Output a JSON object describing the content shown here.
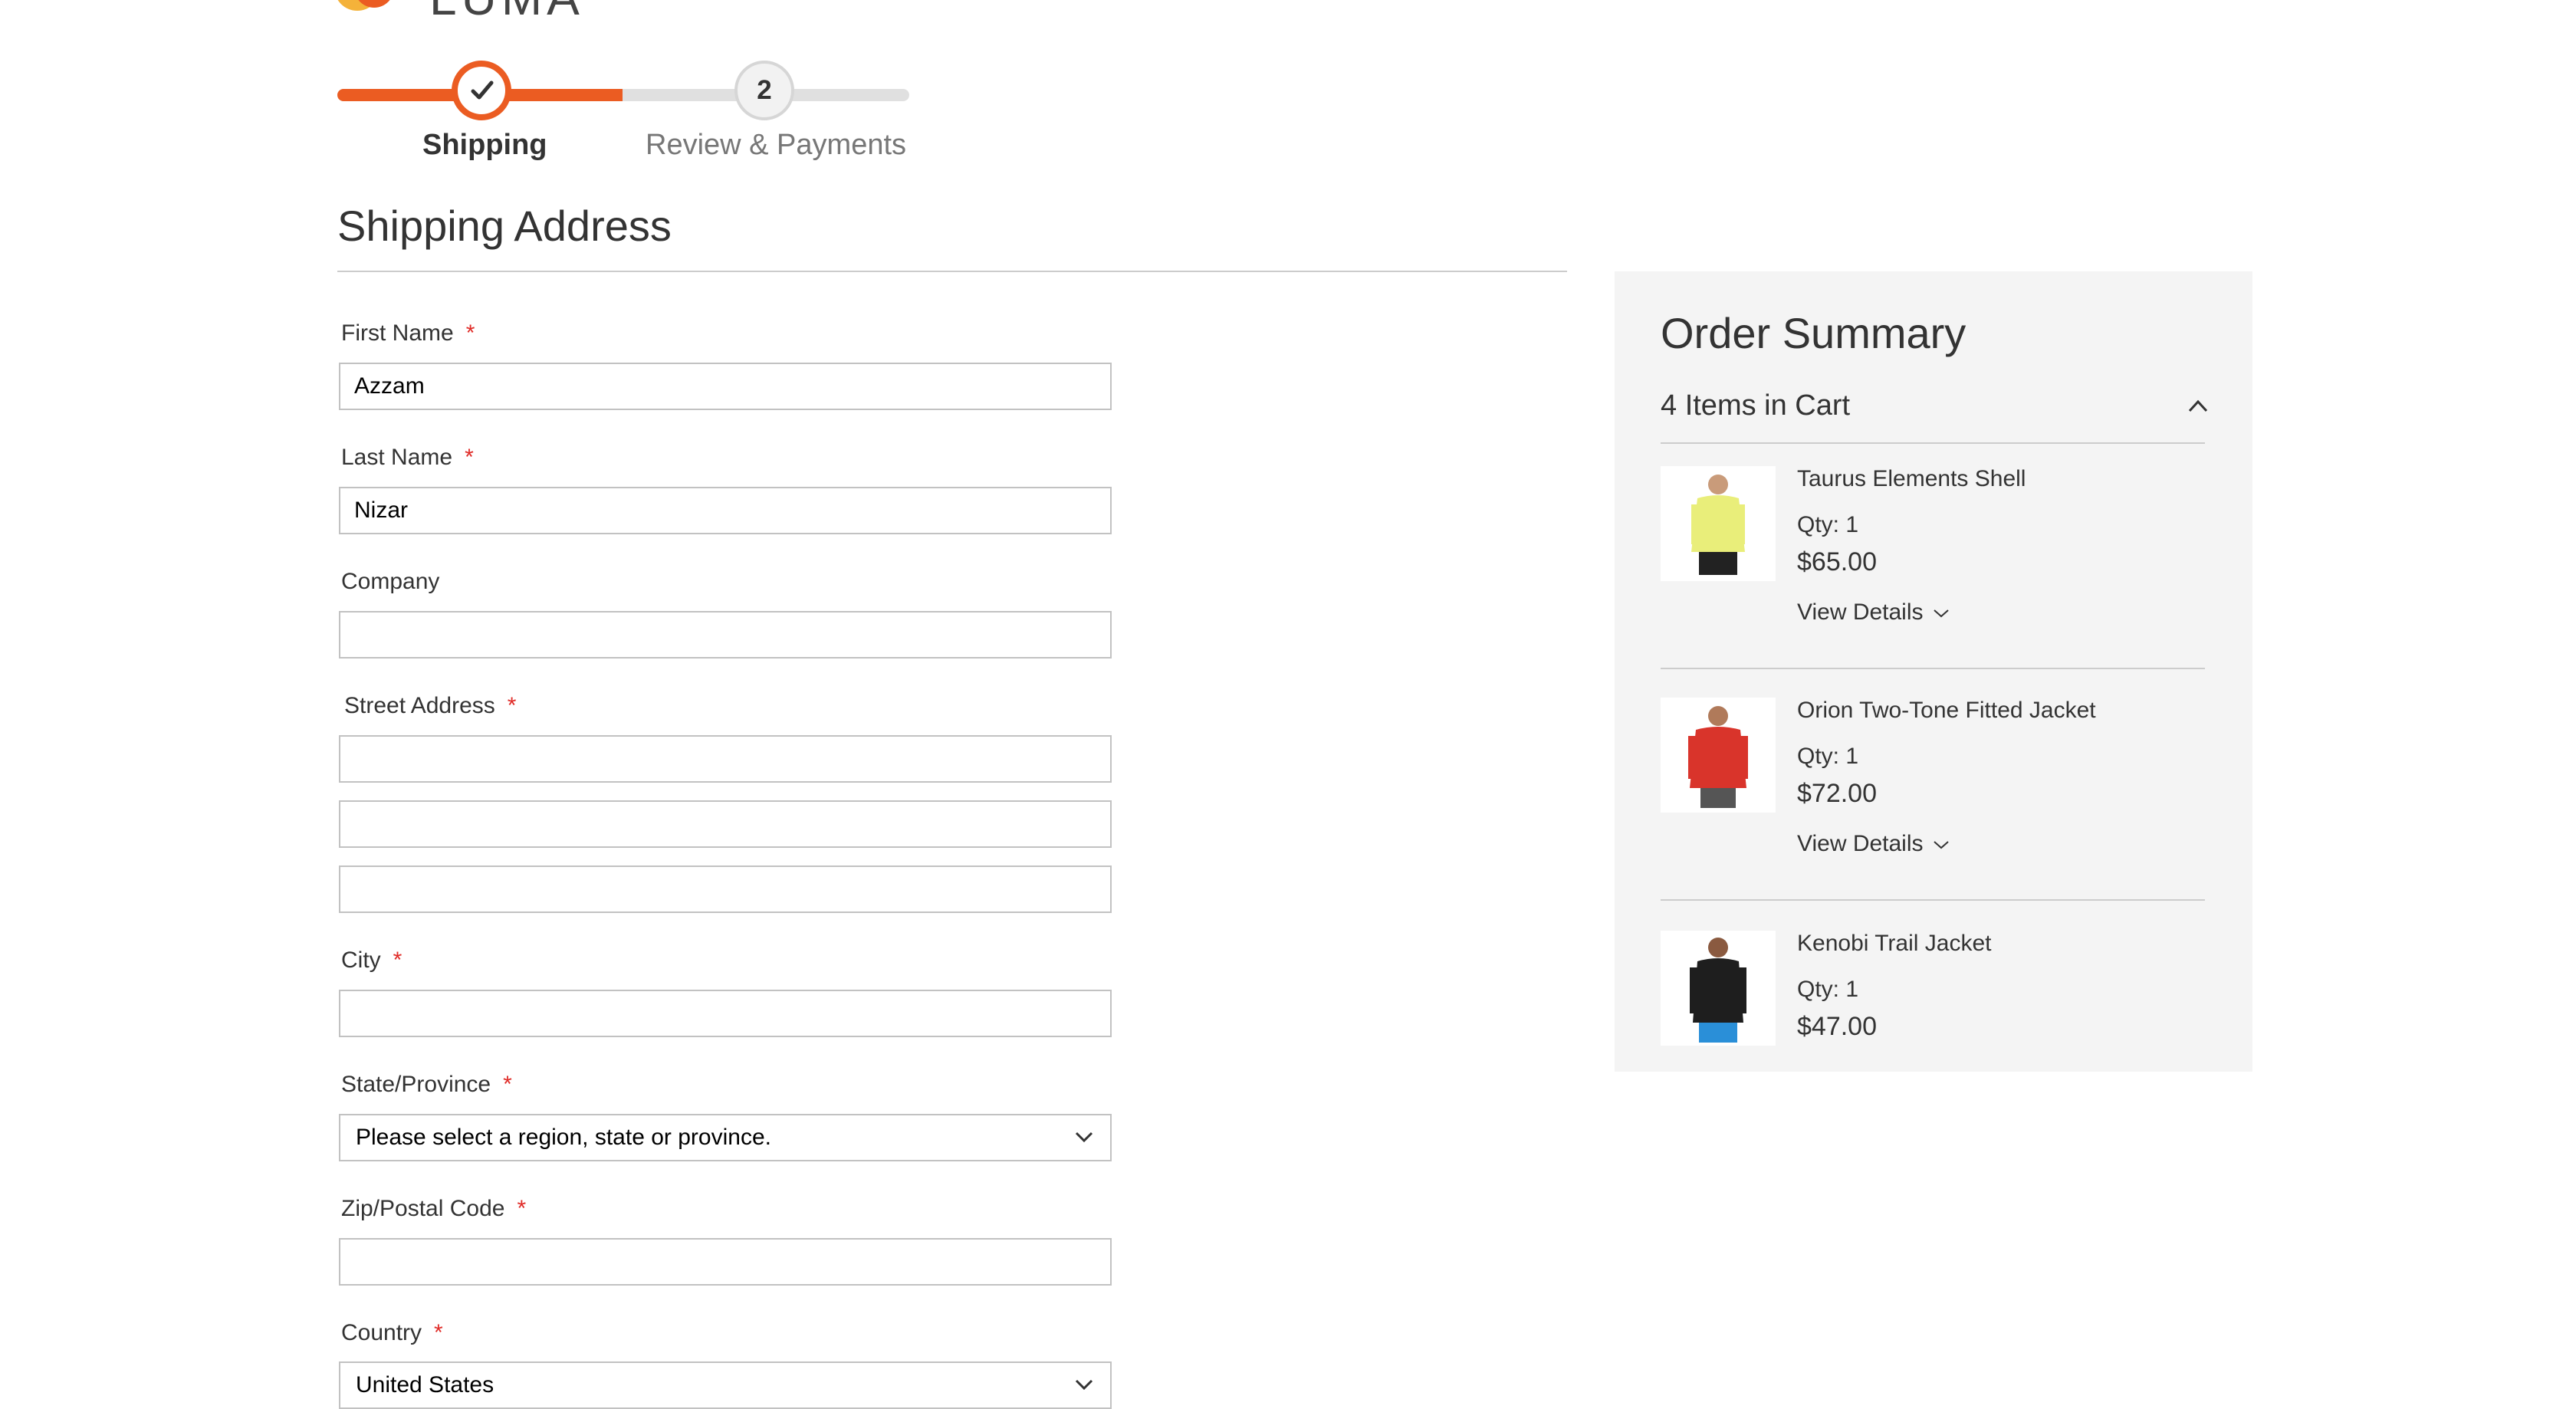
{
  "logo": {
    "text": "LUMA"
  },
  "steps": [
    {
      "number": "1",
      "label": "Shipping"
    },
    {
      "number": "2",
      "label": "Review & Payments"
    }
  ],
  "shipping": {
    "title": "Shipping Address",
    "first_name": {
      "label": "First Name",
      "value": "Azzam"
    },
    "last_name": {
      "label": "Last Name",
      "value": "Nizar"
    },
    "company": {
      "label": "Company",
      "value": ""
    },
    "street": {
      "label": "Street Address",
      "line1": "",
      "line2": "",
      "line3": ""
    },
    "city": {
      "label": "City",
      "value": ""
    },
    "state": {
      "label": "State/Province",
      "value": "Please select a region, state or province."
    },
    "zip": {
      "label": "Zip/Postal Code",
      "value": ""
    },
    "country": {
      "label": "Country",
      "value": "United States"
    },
    "required_mark": "*"
  },
  "summary": {
    "title": "Order Summary",
    "cart_count": "4 Items in Cart",
    "items": [
      {
        "name": "Taurus Elements Shell",
        "qty": "Qty: 1",
        "price": "$65.00",
        "details": "View Details",
        "color": "#e9ee7a"
      },
      {
        "name": "Orion Two-Tone Fitted Jacket",
        "qty": "Qty: 1",
        "price": "$72.00",
        "details": "View Details",
        "color": "#d9342b"
      },
      {
        "name": "Kenobi Trail Jacket",
        "qty": "Qty: 1",
        "price": "$47.00",
        "color": "#1e1e1e"
      }
    ]
  },
  "colors": {
    "accent": "#eb5c22",
    "required": "#e02b27",
    "summary_bg": "#f4f4f4"
  }
}
